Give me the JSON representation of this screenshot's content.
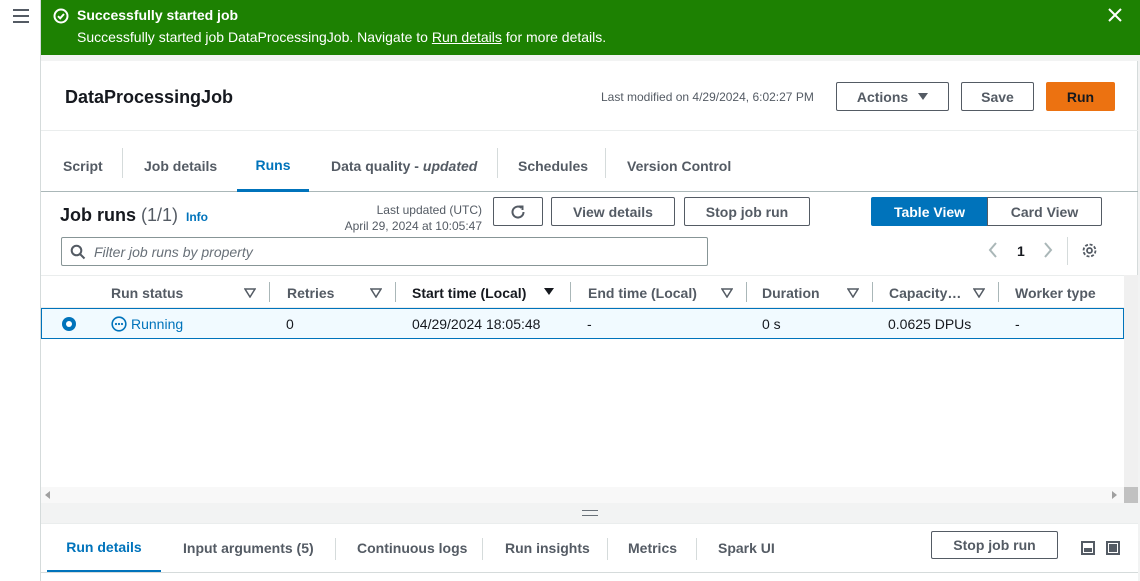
{
  "flash": {
    "title": "Successfully started job",
    "message_prefix": "Successfully started job DataProcessingJob. Navigate to ",
    "link": "Run details",
    "message_suffix": " for more details."
  },
  "header": {
    "job_name": "DataProcessingJob",
    "last_modified": "Last modified on 4/29/2024, 6:02:27 PM",
    "actions_label": "Actions",
    "save_label": "Save",
    "run_label": "Run"
  },
  "tabs": {
    "script": "Script",
    "job_details": "Job details",
    "runs": "Runs",
    "data_quality": "Data quality -",
    "data_quality_badge": "updated",
    "schedules": "Schedules",
    "version_control": "Version Control"
  },
  "runs": {
    "title": "Job runs",
    "count": "(1/1)",
    "info": "Info",
    "last_updated_label": "Last updated (UTC)",
    "last_updated_value": "April 29, 2024 at 10:05:47",
    "view_details": "View details",
    "stop_job_run": "Stop job run",
    "table_view": "Table View",
    "card_view": "Card View",
    "filter_placeholder": "Filter job runs by property",
    "page": "1"
  },
  "table": {
    "columns": [
      "Run status",
      "Retries",
      "Start time (Local)",
      "End time (Local)",
      "Duration",
      "Capacity…",
      "Worker type"
    ],
    "rows": [
      {
        "run_status": "Running",
        "retries": "0",
        "start_time": "04/29/2024 18:05:48",
        "end_time": "-",
        "duration": "0 s",
        "capacity": "0.0625 DPUs",
        "worker_type": "-"
      }
    ]
  },
  "bottom": {
    "tabs": [
      "Run details",
      "Input arguments (5)",
      "Continuous logs",
      "Run insights",
      "Metrics",
      "Spark UI"
    ],
    "stop_job_run": "Stop job run"
  },
  "colors": {
    "success_bg": "#1d8102",
    "accent": "#0073bb",
    "run_button": "#ec7211"
  }
}
